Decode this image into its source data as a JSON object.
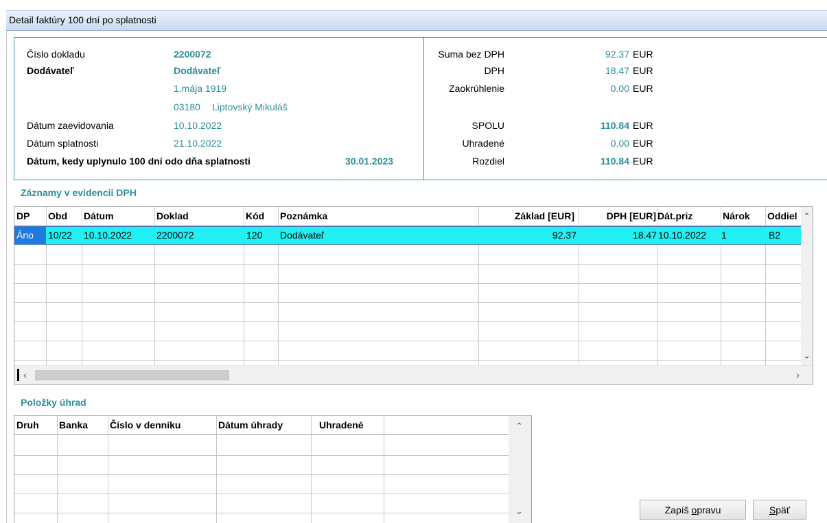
{
  "window": {
    "title": "Detail faktúry 100 dní po splatnosti"
  },
  "header": {
    "doc_no_label": "Číslo dokladu",
    "doc_no": "2200072",
    "supplier_label": "Dodávateľ",
    "supplier_name": "Dodávateľ",
    "supplier_street": "1.mája 1919",
    "supplier_zip": "03180",
    "supplier_city": "Liptovský Mikuláš",
    "recorded_label": "Dátum zaevidovania",
    "recorded_date": "10.10.2022",
    "due_label": "Dátum splatnosti",
    "due_date": "21.10.2022",
    "elapsed_label": "Dátum, kedy uplynulo 100 dní odo dňa splatnosti",
    "elapsed_date": "30.01.2023"
  },
  "totals": {
    "currency": "EUR",
    "rows": [
      {
        "label": "Suma bez DPH",
        "value": "92.37"
      },
      {
        "label": "DPH",
        "value": "18.47"
      },
      {
        "label": "Zaokrúhlenie",
        "value": "0.00"
      },
      {
        "label": "SPOLU",
        "value": "110.84"
      },
      {
        "label": "Uhradené",
        "value": "0.00"
      },
      {
        "label": "Rozdiel",
        "value": "110.84"
      }
    ]
  },
  "vat_section": {
    "title": "Záznamy v evidencii DPH",
    "columns": [
      "DP",
      "Obd",
      "Dátum",
      "Doklad",
      "Kód",
      "Poznámka",
      "Základ [EUR]",
      "DPH [EUR]",
      "Dát.priz",
      "Nárok",
      "Oddiel"
    ],
    "rows": [
      [
        "Áno",
        "10/22",
        "10.10.2022",
        "2200072",
        "120",
        "Dodávateľ",
        "92.37",
        "18.47",
        "10.10.2022",
        "1",
        "B2"
      ]
    ]
  },
  "payments_section": {
    "title": "Položky úhrad",
    "columns": [
      "Druh",
      "Banka",
      "Číslo v denníku",
      "Dátum úhrady",
      "Uhradené"
    ]
  },
  "buttons": {
    "save_pre": "Zapíš ",
    "save_u": "o",
    "save_post": "pravu",
    "back_u": "S",
    "back_post": "päť"
  },
  "colors": {
    "accent": "#2a8f9b",
    "selected_row": "#21eff2",
    "selected_cell": "#1c7ae0"
  }
}
